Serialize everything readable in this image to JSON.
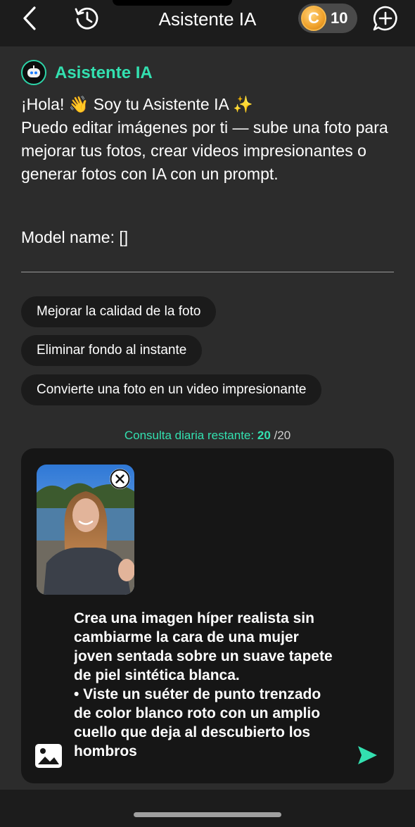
{
  "header": {
    "title": "Asistente IA",
    "coin_balance": "10",
    "coin_letter": "C",
    "icons": [
      "chevron-left-icon",
      "history-icon",
      "coin-icon",
      "new-chat-icon"
    ]
  },
  "assistant": {
    "name": "Asistente IA",
    "greeting": "¡Hola! 👋 Soy tu Asistente IA ✨",
    "intro": "Puedo editar imágenes por ti — sube una foto para mejorar tus fotos, crear videos impresionantes o generar fotos con IA con un prompt.",
    "model_line": "Model name: []"
  },
  "suggestions": [
    {
      "label": "Mejorar la calidad de la foto"
    },
    {
      "label": "Eliminar fondo al instante"
    },
    {
      "label": "Convierte una foto en un video impresionante"
    }
  ],
  "quota": {
    "label": "Consulta diaria restante:",
    "remaining": "20",
    "total": "/20"
  },
  "composer": {
    "prompt_paragraph1": "Crea una imagen híper realista sin cambiarme la cara de una mujer joven sentada sobre un suave tapete de piel sintética blanca.",
    "prompt_paragraph2": "• Viste un suéter de punto trenzado de color blanco roto con un amplio cuello que deja al descubierto los hombros"
  },
  "colors": {
    "accent": "#33e0b0",
    "background": "#2c2c2c",
    "header_bg": "#1c1c1c",
    "composer_bg": "#161616",
    "chip_bg": "#1b1b1b",
    "coin": "#f0a12a"
  }
}
